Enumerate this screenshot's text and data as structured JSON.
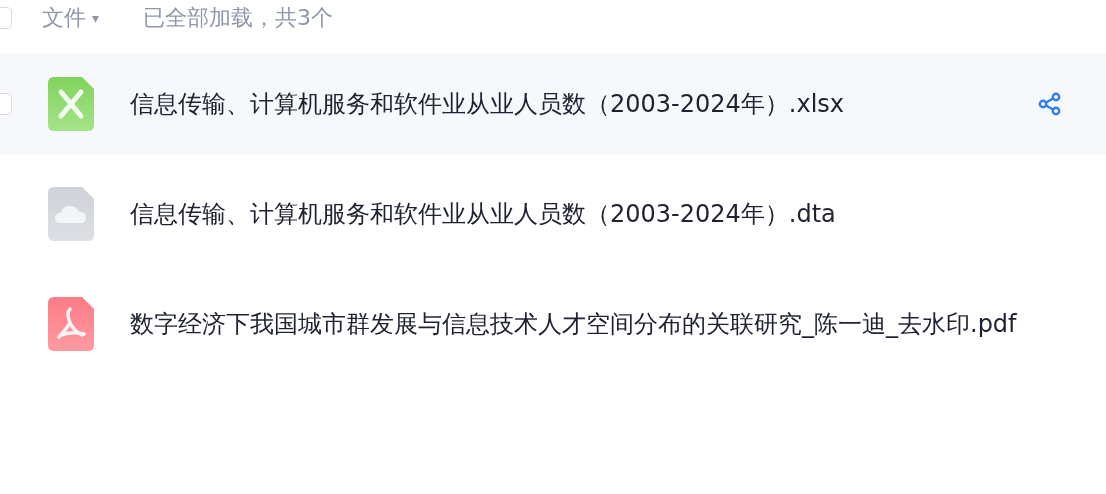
{
  "header": {
    "checked": false,
    "column_label": "文件",
    "sort_caret": "▾",
    "status": "已全部加载，共3个"
  },
  "files": [
    {
      "name": "信息传输、计算机服务和软件业从业人员数（2003-2024年）.xlsx",
      "kind": "xlsx",
      "hovered": true,
      "checked": false
    },
    {
      "name": "信息传输、计算机服务和软件业从业人员数（2003-2024年）.dta",
      "kind": "cloud",
      "hovered": false,
      "checked": false
    },
    {
      "name": "数字经济下我国城市群发展与信息技术人才空间分布的关联研究_陈一迪_去水印.pdf",
      "kind": "pdf",
      "hovered": false,
      "checked": false
    }
  ]
}
